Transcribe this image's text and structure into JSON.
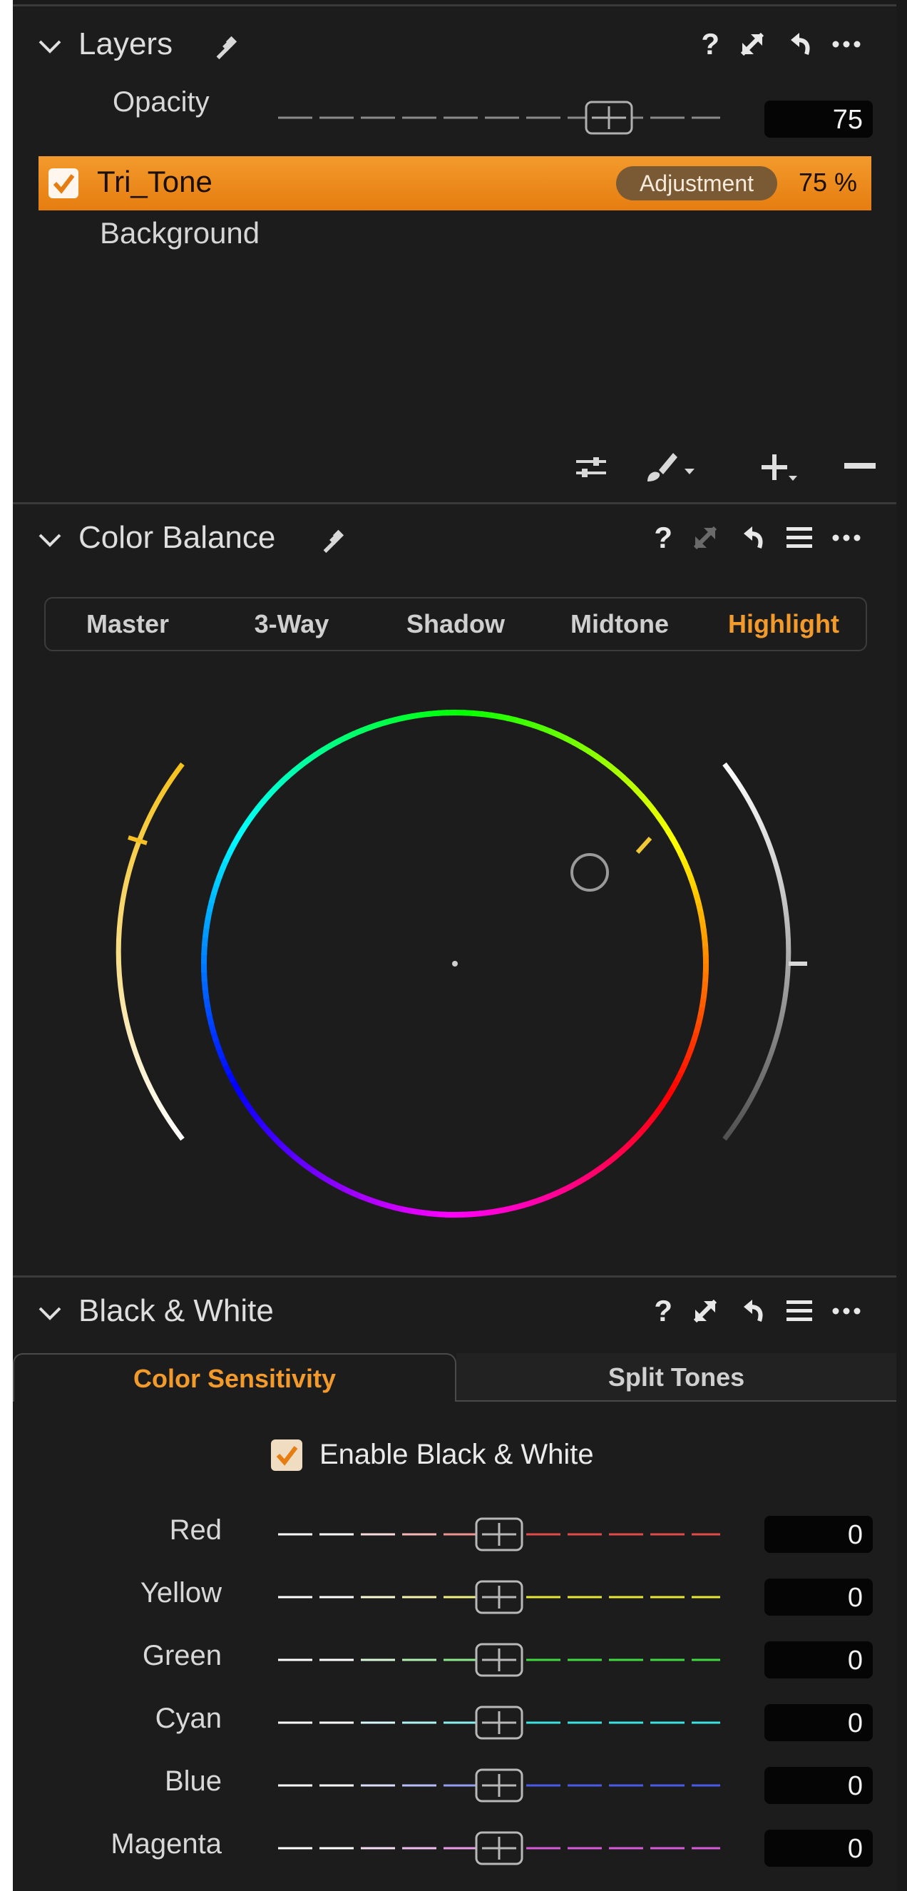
{
  "layers": {
    "title": "Layers",
    "opacity_label": "Opacity",
    "opacity_value": "75",
    "opacity_fraction": 0.75,
    "items": [
      {
        "name": "Tri_Tone",
        "badge": "Adjustment",
        "percent": "75 %",
        "checked": true,
        "active": true
      },
      {
        "name": "Background",
        "active": false
      }
    ]
  },
  "color_balance": {
    "title": "Color Balance",
    "tabs": [
      "Master",
      "3-Way",
      "Shadow",
      "Midtone",
      "Highlight"
    ],
    "active_tab": "Highlight"
  },
  "black_white": {
    "title": "Black & White",
    "tabs": [
      "Color Sensitivity",
      "Split Tones"
    ],
    "active_tab": "Color Sensitivity",
    "enable_label": "Enable Black & White",
    "enabled": true,
    "sliders": [
      {
        "label": "Red",
        "value": "0",
        "color": "#e24a4a"
      },
      {
        "label": "Yellow",
        "value": "0",
        "color": "#e7e735"
      },
      {
        "label": "Green",
        "value": "0",
        "color": "#3fd93f"
      },
      {
        "label": "Cyan",
        "value": "0",
        "color": "#3ae2e2"
      },
      {
        "label": "Blue",
        "value": "0",
        "color": "#4a5ae8"
      },
      {
        "label": "Magenta",
        "value": "0",
        "color": "#d95ad9"
      }
    ]
  },
  "colors": {
    "accent": "#f39a2c",
    "panel_bg": "#1c1c1c"
  },
  "icons": [
    "chevron-down-icon",
    "pipette-icon",
    "help-icon",
    "expand-icon",
    "reset-icon",
    "menu-icon",
    "more-icon",
    "sliders-icon",
    "brush-icon",
    "add-icon",
    "remove-icon"
  ]
}
